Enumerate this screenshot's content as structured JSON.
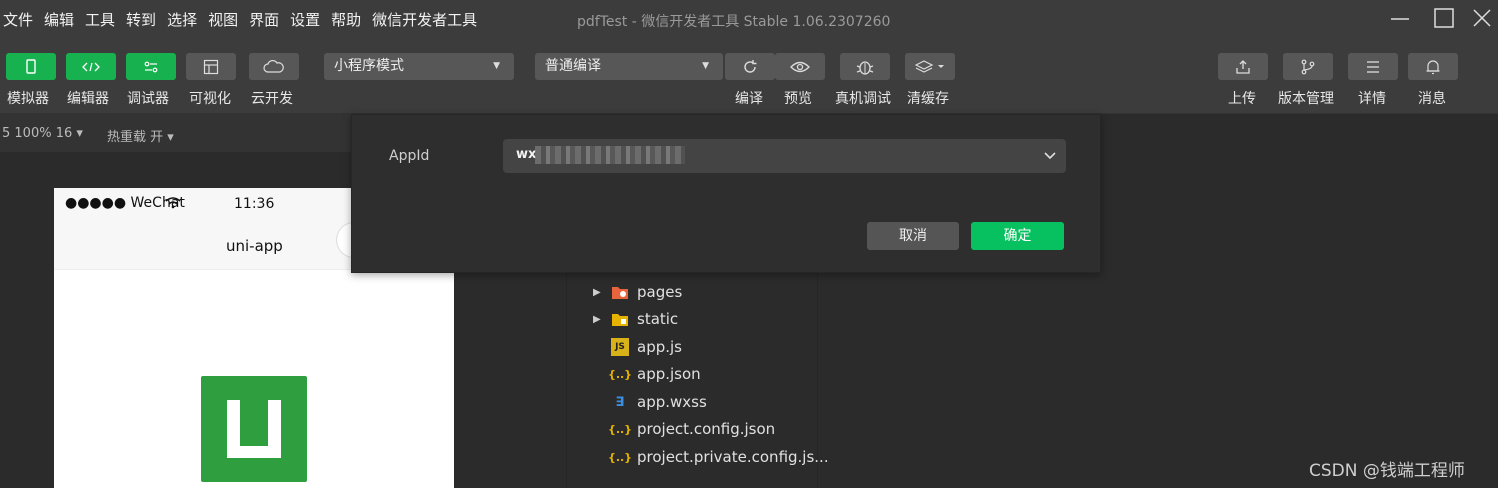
{
  "menu": [
    "文件",
    "编辑",
    "工具",
    "转到",
    "选择",
    "视图",
    "界面",
    "设置",
    "帮助",
    "微信开发者工具"
  ],
  "window_title": "pdfTest - 微信开发者工具 Stable 1.06.2307260",
  "toolbar": {
    "left_buttons": [
      {
        "label": "模拟器",
        "icon": "phone-icon"
      },
      {
        "label": "编辑器",
        "icon": "code-icon"
      },
      {
        "label": "调试器",
        "icon": "debug-icon"
      },
      {
        "label": "可视化",
        "icon": "layout-icon"
      },
      {
        "label": "云开发",
        "icon": "cloud-icon"
      }
    ],
    "mode_select": "小程序模式",
    "compile_select": "普通编译",
    "center_buttons": [
      {
        "label": "编译",
        "icon": "refresh-icon"
      },
      {
        "label": "预览",
        "icon": "eye-icon"
      },
      {
        "label": "真机调试",
        "icon": "bug-icon"
      },
      {
        "label": "清缓存",
        "icon": "layers-icon"
      }
    ],
    "right_buttons": [
      {
        "label": "上传",
        "icon": "upload-icon"
      },
      {
        "label": "版本管理",
        "icon": "branch-icon"
      },
      {
        "label": "详情",
        "icon": "menu-icon"
      },
      {
        "label": "消息",
        "icon": "bell-icon"
      }
    ]
  },
  "subbar": {
    "zoom": "5 100% 16",
    "hot_reload": "热重载 开"
  },
  "simulator": {
    "carrier": "●●●●● WeChat",
    "time": "11:36",
    "nav_title": "uni-app"
  },
  "dialog": {
    "appid_label": "AppId",
    "appid_value": "wx",
    "cancel": "取消",
    "confirm": "确定"
  },
  "file_tree": [
    {
      "name": "pages",
      "type": "folder",
      "icon": "pages-folder-icon",
      "expandable": true
    },
    {
      "name": "static",
      "type": "folder",
      "icon": "folder-icon",
      "expandable": true
    },
    {
      "name": "app.js",
      "type": "js",
      "icon": "js-file-icon"
    },
    {
      "name": "app.json",
      "type": "json",
      "icon": "json-file-icon"
    },
    {
      "name": "app.wxss",
      "type": "wxss",
      "icon": "wxss-file-icon"
    },
    {
      "name": "project.config.json",
      "type": "json",
      "icon": "json-file-icon"
    },
    {
      "name": "project.private.config.js...",
      "type": "json",
      "icon": "json-file-icon"
    }
  ],
  "watermark": "CSDN @钱端工程师",
  "colors": {
    "primary_green": "#07c160",
    "toolbar_bg": "#3c3c3c",
    "panel_bg": "#2b2b2b"
  }
}
